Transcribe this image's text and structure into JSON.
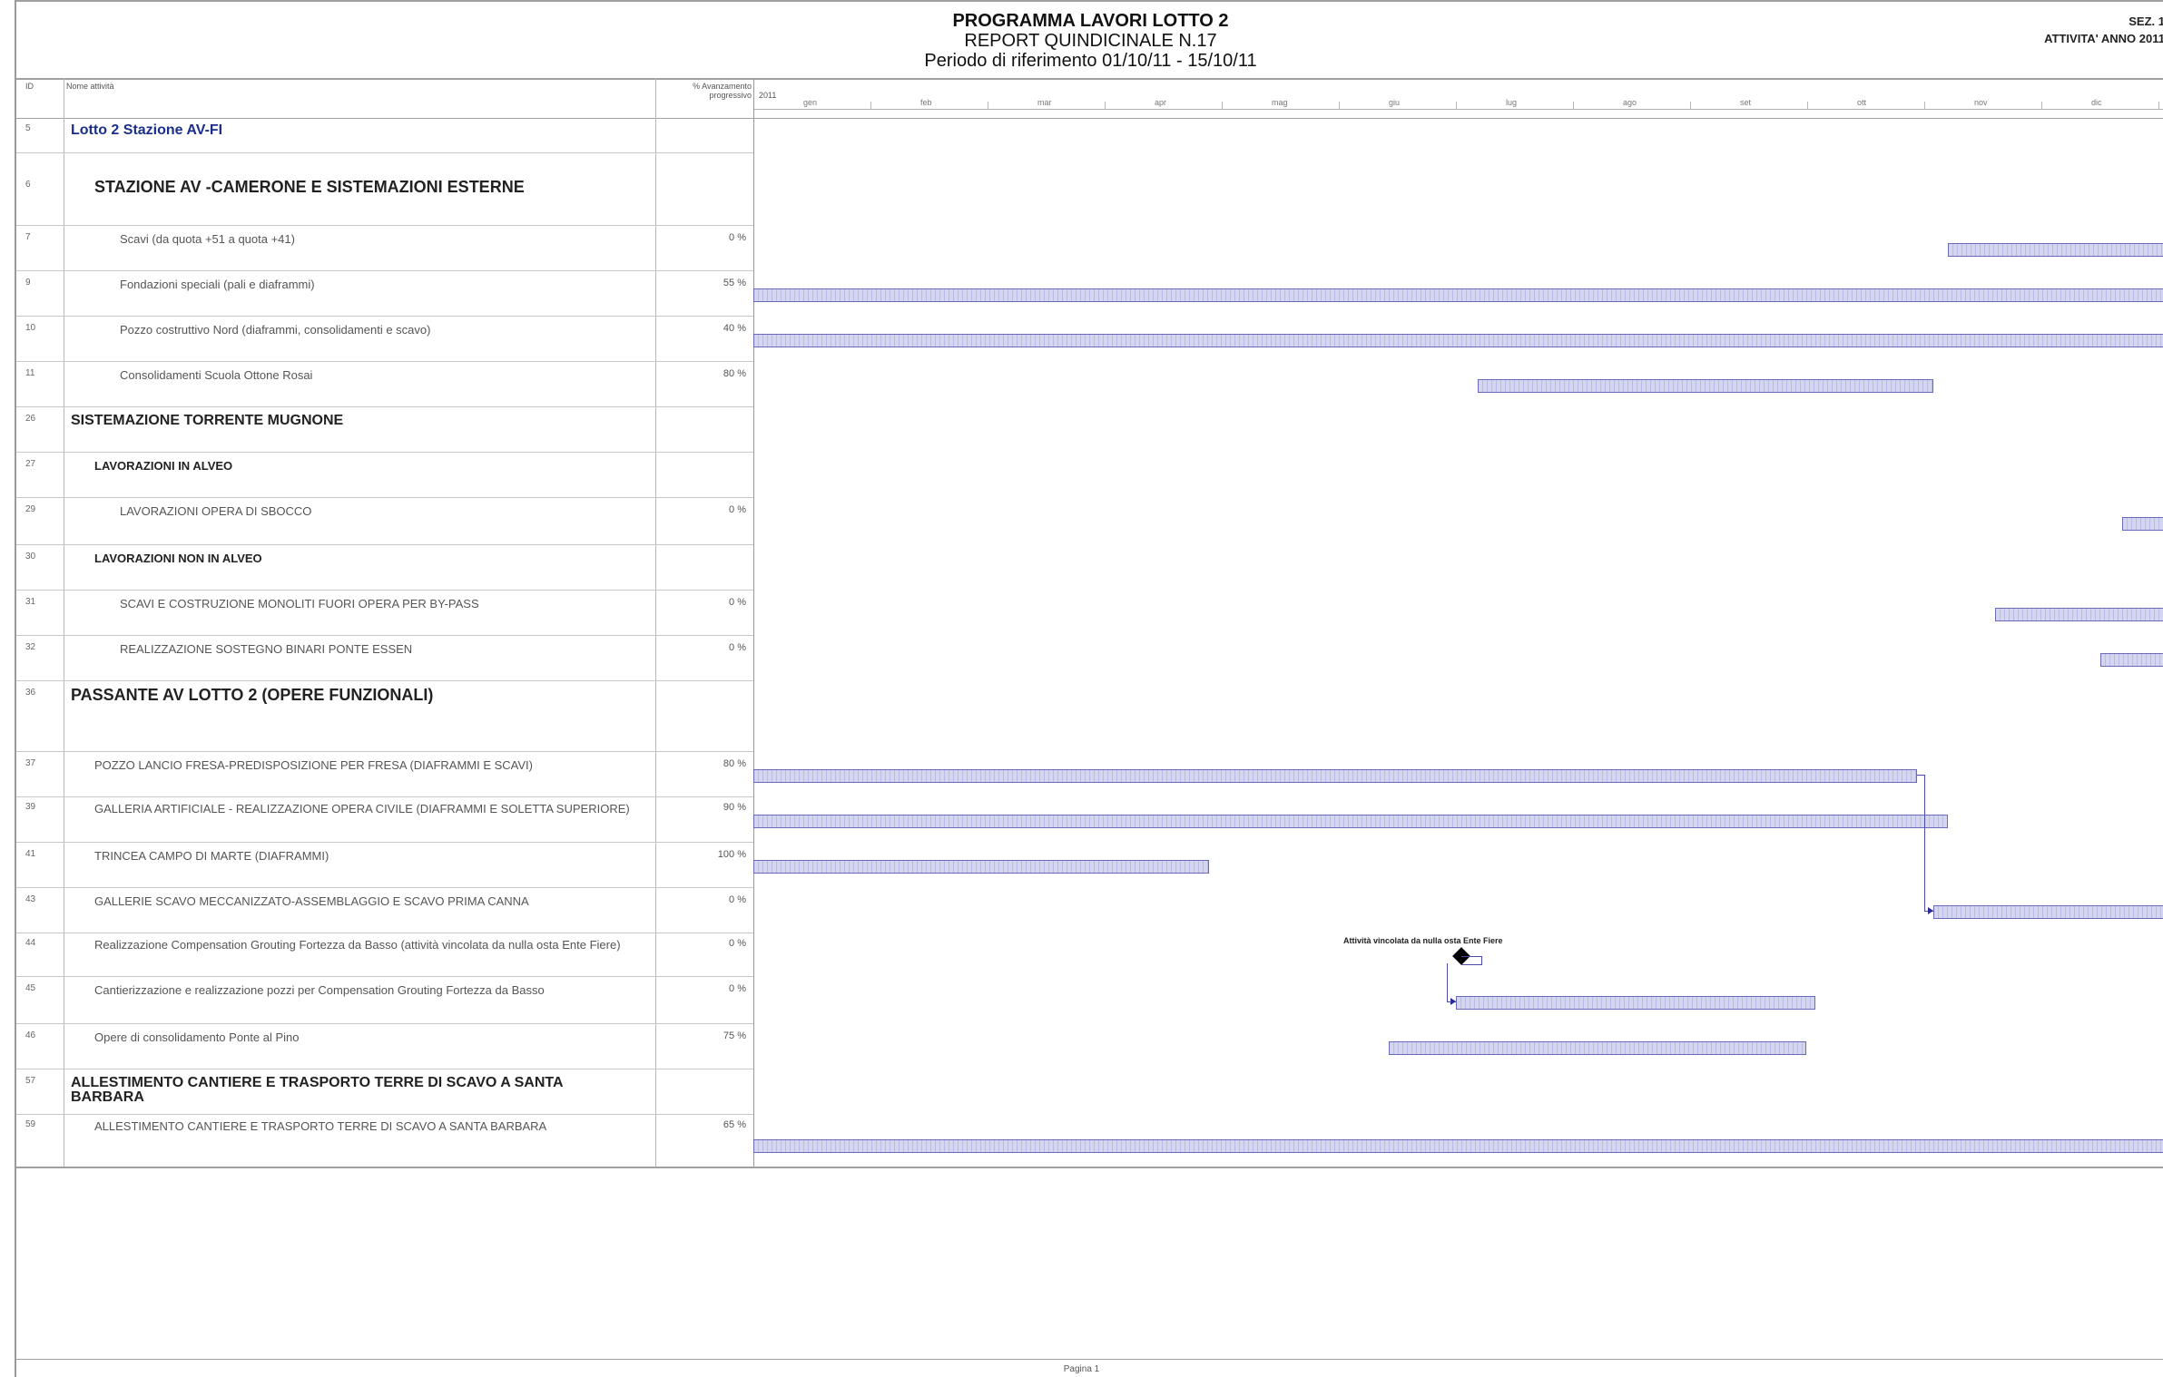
{
  "header": {
    "title": "PROGRAMMA LAVORI LOTTO 2",
    "subtitle": "REPORT QUINDICINALE N.17",
    "period": "Periodo di riferimento 01/10/11 - 15/10/11",
    "sez": "SEZ. 1",
    "activity_year": "ATTIVITA' ANNO 2011"
  },
  "columns": {
    "id": "ID",
    "name": "Nome attività",
    "progress": "% Avanzamento progressivo",
    "year": "2011"
  },
  "months": [
    "gen",
    "feb",
    "mar",
    "apr",
    "mag",
    "giu",
    "lug",
    "ago",
    "set",
    "ott",
    "nov",
    "dic"
  ],
  "rows": [
    {
      "id": "5",
      "name": "Lotto 2 Stazione AV-FI",
      "pct": ""
    },
    {
      "id": "6",
      "name": "STAZIONE AV -CAMERONE E SISTEMAZIONI ESTERNE",
      "pct": ""
    },
    {
      "id": "7",
      "name": "Scavi (da quota +51 a quota +41)",
      "pct": "0 %"
    },
    {
      "id": "9",
      "name": "Fondazioni speciali (pali e diaframmi)",
      "pct": "55 %"
    },
    {
      "id": "10",
      "name": "Pozzo costruttivo Nord (diaframmi, consolidamenti e scavo)",
      "pct": "40 %"
    },
    {
      "id": "11",
      "name": "Consolidamenti Scuola Ottone Rosai",
      "pct": "80 %"
    },
    {
      "id": "26",
      "name": "SISTEMAZIONE TORRENTE MUGNONE",
      "pct": ""
    },
    {
      "id": "27",
      "name": "LAVORAZIONI IN ALVEO",
      "pct": ""
    },
    {
      "id": "29",
      "name": "LAVORAZIONI OPERA DI SBOCCO",
      "pct": "0 %"
    },
    {
      "id": "30",
      "name": "LAVORAZIONI NON IN ALVEO",
      "pct": ""
    },
    {
      "id": "31",
      "name": "SCAVI E COSTRUZIONE MONOLITI FUORI OPERA PER BY-PASS",
      "pct": "0 %"
    },
    {
      "id": "32",
      "name": "REALIZZAZIONE SOSTEGNO BINARI PONTE ESSEN",
      "pct": "0 %"
    },
    {
      "id": "36",
      "name": "PASSANTE AV LOTTO 2 (OPERE FUNZIONALI)",
      "pct": ""
    },
    {
      "id": "37",
      "name": "POZZO LANCIO FRESA-PREDISPOSIZIONE PER FRESA (DIAFRAMMI E SCAVI)",
      "pct": "80 %"
    },
    {
      "id": "39",
      "name": "GALLERIA ARTIFICIALE - REALIZZAZIONE OPERA CIVILE (DIAFRAMMI E SOLETTA SUPERIORE)",
      "pct": "90 %"
    },
    {
      "id": "41",
      "name": "TRINCEA CAMPO DI MARTE (DIAFRAMMI)",
      "pct": "100 %"
    },
    {
      "id": "43",
      "name": "GALLERIE SCAVO MECCANIZZATO-ASSEMBLAGGIO E SCAVO PRIMA CANNA",
      "pct": "0 %"
    },
    {
      "id": "44",
      "name": "Realizzazione Compensation Grouting Fortezza da Basso (attività vincolata da nulla osta Ente Fiere)",
      "pct": "0 %"
    },
    {
      "id": "45",
      "name": "Cantierizzazione e realizzazione pozzi per Compensation Grouting Fortezza da Basso",
      "pct": "0 %"
    },
    {
      "id": "46",
      "name": "Opere di consolidamento Ponte al Pino",
      "pct": "75 %"
    },
    {
      "id": "57",
      "name": "ALLESTIMENTO CANTIERE E TRASPORTO TERRE DI SCAVO A SANTA BARBARA",
      "pct": ""
    },
    {
      "id": "59",
      "name": "ALLESTIMENTO CANTIERE E TRASPORTO TERRE DI SCAVO A SANTA BARBARA",
      "pct": "65 %"
    }
  ],
  "milestone_label": "Attività vincolata da nulla osta Ente Fiere",
  "footer": "Pagina 1"
}
